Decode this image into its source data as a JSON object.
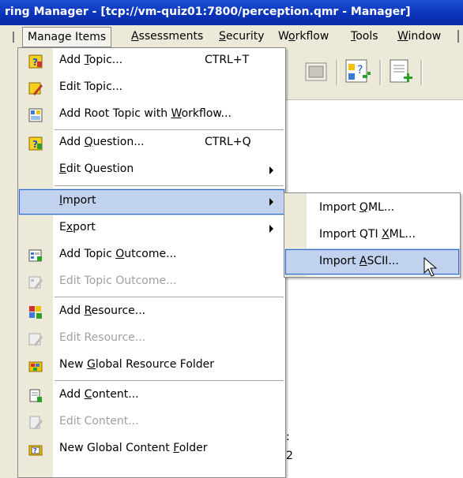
{
  "window": {
    "title": "ring Manager - [tcp://vm-quiz01:7800/perception.qmr - Manager]"
  },
  "menubar": {
    "items": [
      {
        "pre": "",
        "key": "",
        "post": "Manage Items"
      },
      {
        "pre": "",
        "key": "A",
        "post": "ssessments"
      },
      {
        "pre": "",
        "key": "S",
        "post": "ecurity"
      },
      {
        "pre": "W",
        "key": "o",
        "post": "rkflow"
      },
      {
        "pre": "",
        "key": "T",
        "post": "ools"
      },
      {
        "pre": "",
        "key": "W",
        "post": "indow"
      }
    ]
  },
  "menu": {
    "items": [
      {
        "pre": "Add ",
        "key": "T",
        "post": "opic...",
        "shortcut": "CTRL+T",
        "icon": "add-topic-icon"
      },
      {
        "pre": "Edit Topic...",
        "key": "",
        "post": "",
        "shortcut": "",
        "icon": "edit-topic-icon"
      },
      {
        "pre": "Add Root Topic with ",
        "key": "W",
        "post": "orkflow...",
        "shortcut": "",
        "icon": "root-topic-icon"
      },
      {
        "pre": "Add ",
        "key": "Q",
        "post": "uestion...",
        "shortcut": "CTRL+Q",
        "icon": "add-question-icon"
      },
      {
        "pre": "",
        "key": "E",
        "post": "dit Question",
        "shortcut": "",
        "icon": ""
      },
      {
        "pre": "",
        "key": "I",
        "post": "mport",
        "shortcut": "",
        "icon": ""
      },
      {
        "pre": "E",
        "key": "x",
        "post": "port",
        "shortcut": "",
        "icon": ""
      },
      {
        "pre": "Add Topic ",
        "key": "O",
        "post": "utcome...",
        "shortcut": "",
        "icon": "add-outcome-icon"
      },
      {
        "pre": "Edit Topic Outcome...",
        "key": "",
        "post": "",
        "shortcut": "",
        "icon": "edit-outcome-icon"
      },
      {
        "pre": "Add ",
        "key": "R",
        "post": "esource...",
        "shortcut": "",
        "icon": "add-resource-icon"
      },
      {
        "pre": "Edit Resource...",
        "key": "",
        "post": "",
        "shortcut": "",
        "icon": "edit-resource-icon"
      },
      {
        "pre": "New ",
        "key": "G",
        "post": "lobal Resource Folder",
        "shortcut": "",
        "icon": "resource-folder-icon"
      },
      {
        "pre": "Add ",
        "key": "C",
        "post": "ontent...",
        "shortcut": "",
        "icon": "add-content-icon"
      },
      {
        "pre": "Edit Content...",
        "key": "",
        "post": "",
        "shortcut": "",
        "icon": "edit-content-icon"
      },
      {
        "pre": "New Global Content ",
        "key": "F",
        "post": "older",
        "shortcut": "",
        "icon": "content-folder-icon"
      }
    ]
  },
  "submenu": {
    "items": [
      {
        "pre": "Import ",
        "key": "Q",
        "post": "ML..."
      },
      {
        "pre": "Import QTI ",
        "key": "X",
        "post": "ML..."
      },
      {
        "pre": "Import ",
        "key": "A",
        "post": "SCII..."
      }
    ]
  },
  "background": {
    "fragment_a": ":",
    "fragment_b": "2"
  },
  "colors": {
    "titlebar": "#0a32b8",
    "highlight": "#c1d2ee",
    "highlight_border": "#316ac5",
    "chrome": "#ece9d8"
  }
}
